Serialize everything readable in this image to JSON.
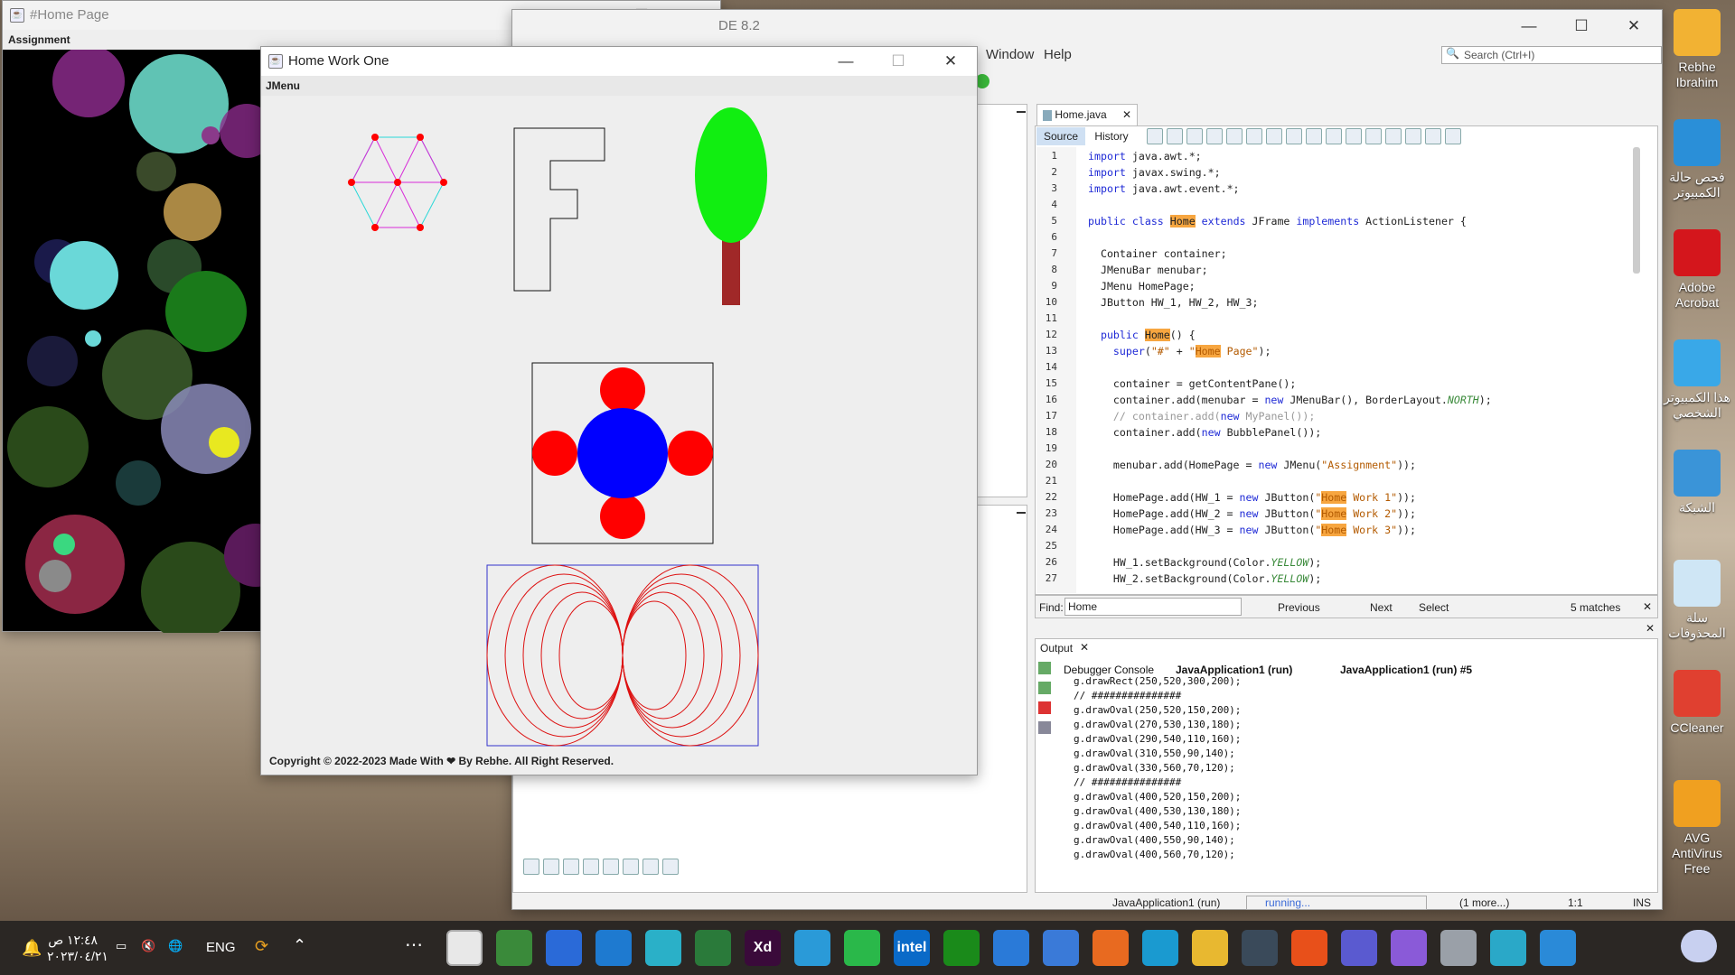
{
  "home_page_window": {
    "title": "#Home Page",
    "menu": "Assignment"
  },
  "home_work_window": {
    "title": "Home Work One",
    "menu": "JMenu",
    "footer": "Copyright © 2022-2023 Made With ❤ By Rebhe. All Right Reserved."
  },
  "netbeans": {
    "title_fragment": "DE 8.2",
    "menu": [
      "Window",
      "Help"
    ],
    "search_placeholder": "Search (Ctrl+I)",
    "editor_tab": "Home.java",
    "source_tab": "Source",
    "history_tab": "History",
    "code_lines": [
      "import java.awt.*;",
      "import javax.swing.*;",
      "import java.awt.event.*;",
      "",
      "public class Home extends JFrame implements ActionListener {",
      "",
      "  Container container;",
      "  JMenuBar menubar;",
      "  JMenu HomePage;",
      "  JButton HW_1, HW_2, HW_3;",
      "",
      "  public Home() {",
      "    super(\"#\" + \"Home Page\");",
      "",
      "    container = getContentPane();",
      "    container.add(menubar = new JMenuBar(), BorderLayout.NORTH);",
      "    // container.add(new MyPanel());",
      "    container.add(new BubblePanel());",
      "",
      "    menubar.add(HomePage = new JMenu(\"Assignment\"));",
      "",
      "    HomePage.add(HW_1 = new JButton(\"Home Work 1\"));",
      "    HomePage.add(HW_2 = new JButton(\"Home Work 2\"));",
      "    HomePage.add(HW_3 = new JButton(\"Home Work 3\"));",
      "",
      "    HW_1.setBackground(Color.YELLOW);",
      "    HW_2.setBackground(Color.YELLOW);"
    ],
    "find_label": "Find:",
    "find_value": "Home",
    "find_previous": "Previous",
    "find_next": "Next",
    "find_select": "Select",
    "find_matches": "5 matches",
    "output_label": "Output",
    "output_tabs": [
      "Debugger Console",
      "JavaApplication1 (run)",
      "JavaApplication1 (run) #5"
    ],
    "output_lines": [
      "g.drawRect(250,520,300,200);",
      "// ###############",
      "g.drawOval(250,520,150,200);",
      "g.drawOval(270,530,130,180);",
      "g.drawOval(290,540,110,160);",
      "g.drawOval(310,550,90,140);",
      "g.drawOval(330,560,70,120);",
      "// ###############",
      "g.drawOval(400,520,150,200);",
      "g.drawOval(400,530,130,180);",
      "g.drawOval(400,540,110,160);",
      "g.drawOval(400,550,90,140);",
      "g.drawOval(400,560,70,120);"
    ],
    "status_project": "JavaApplication1 (run)",
    "status_running": "running...",
    "status_more": "(1 more...)",
    "status_pos": "1:1",
    "status_mode": "INS"
  },
  "desktop_icons": [
    {
      "label": "Rebhe Ibrahim",
      "color": "#f2b233"
    },
    {
      "label": "فحص حالة الكمبيوتر",
      "color": "#2a8fd8"
    },
    {
      "label": "Adobe Acrobat",
      "color": "#d4161c"
    },
    {
      "label": "هذا الكمبيوتر الشخصي",
      "color": "#39a8e8"
    },
    {
      "label": "الشبكة",
      "color": "#3a94d8"
    },
    {
      "label": "سلة المحذوفات",
      "color": "#cfe6f5"
    },
    {
      "label": "CCleaner",
      "color": "#e04030"
    },
    {
      "label": "AVG AntiVirus Free",
      "color": "#f0a020"
    }
  ],
  "taskbar": {
    "time": "١٢:٤٨ ص",
    "date": "٢٠٢٣/٠٤/٢١",
    "lang": "ENG"
  },
  "taskbar_apps": [
    {
      "name": "java-app",
      "color": "#e8e8e8",
      "text": ""
    },
    {
      "name": "chrome",
      "color": "#3a8a3a",
      "text": ""
    },
    {
      "name": "media",
      "color": "#2a6ad8",
      "text": ""
    },
    {
      "name": "vscode",
      "color": "#1e7ad0",
      "text": ""
    },
    {
      "name": "app-cube",
      "color": "#2ab0c8",
      "text": ""
    },
    {
      "name": "excel-like",
      "color": "#2a7a3a",
      "text": ""
    },
    {
      "name": "adobe-xd",
      "color": "#3a0a3a",
      "text": "Xd"
    },
    {
      "name": "telegram",
      "color": "#2a9ad8",
      "text": ""
    },
    {
      "name": "whatsapp",
      "color": "#2ab84a",
      "text": ""
    },
    {
      "name": "intel",
      "color": "#0a6ac8",
      "text": "intel"
    },
    {
      "name": "xbox",
      "color": "#1a8a1a",
      "text": ""
    },
    {
      "name": "mail",
      "color": "#2a7ad8",
      "text": ""
    },
    {
      "name": "store",
      "color": "#3a7ad8",
      "text": ""
    },
    {
      "name": "app-orange",
      "color": "#e86a20",
      "text": ""
    },
    {
      "name": "edge",
      "color": "#1a9ad0",
      "text": ""
    },
    {
      "name": "files",
      "color": "#e8b830",
      "text": ""
    },
    {
      "name": "calculator",
      "color": "#3a4a5a",
      "text": ""
    },
    {
      "name": "firefox",
      "color": "#e8501a",
      "text": ""
    },
    {
      "name": "teams",
      "color": "#5a5ad0",
      "text": ""
    },
    {
      "name": "copilot",
      "color": "#8a5ad8",
      "text": ""
    },
    {
      "name": "taskview",
      "color": "#9aa0a8",
      "text": ""
    },
    {
      "name": "search",
      "color": "#2aa8c8",
      "text": ""
    },
    {
      "name": "start",
      "color": "#2a8ad8",
      "text": ""
    }
  ]
}
